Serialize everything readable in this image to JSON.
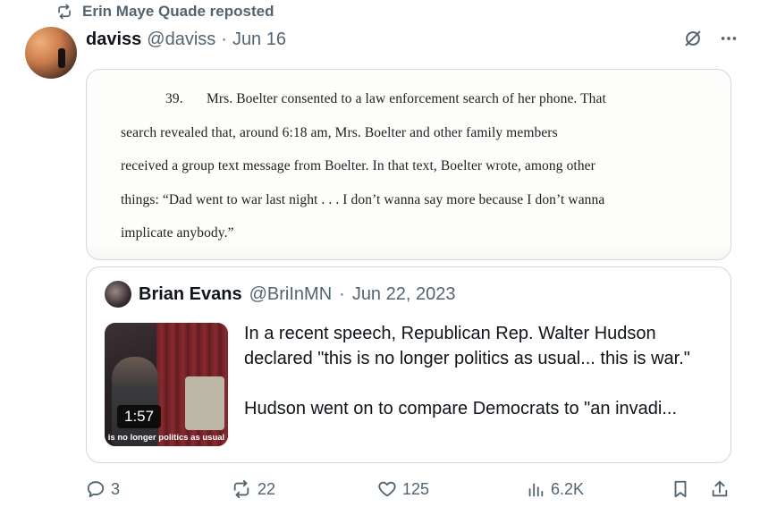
{
  "repost": {
    "text": "Erin Maye Quade reposted"
  },
  "post": {
    "display_name": "daviss",
    "handle": "@daviss",
    "date": "Jun 16",
    "document_lines": [
      "39.",
      "Mrs. Boelter consented to a law enforcement search of her phone. That",
      "search revealed that, around 6:18 am, Mrs. Boelter and other family members",
      "received a group text message from Boelter. In that text, Boelter wrote, among other",
      "things: “Dad went to war last night . . . I don’t wanna say more because I don’t wanna",
      "implicate anybody.”"
    ],
    "underline_color": "#b01fb8"
  },
  "quoted": {
    "display_name": "Brian Evans",
    "handle": "@BriInMN",
    "date": "Jun 22, 2023",
    "video_duration": "1:57",
    "video_caption": "is no longer politics as usual",
    "text_p1": "In a recent speech, Republican Rep. Walter Hudson declared \"this is no longer politics as usual... this is war.\"",
    "text_p2": "Hudson went on to compare Democrats to \"an invadi..."
  },
  "actions": {
    "replies": "3",
    "reposts": "22",
    "likes": "125",
    "views": "6.2K"
  },
  "icons": {
    "repost": "repost-icon",
    "grok": "grok-icon",
    "more": "more-icon",
    "reply": "reply-icon",
    "like": "heart-icon",
    "views": "views-icon",
    "bookmark": "bookmark-icon",
    "share": "share-icon"
  },
  "colors": {
    "secondary_text": "#536471",
    "primary_text": "#0f1419",
    "border": "#cfd9de"
  }
}
